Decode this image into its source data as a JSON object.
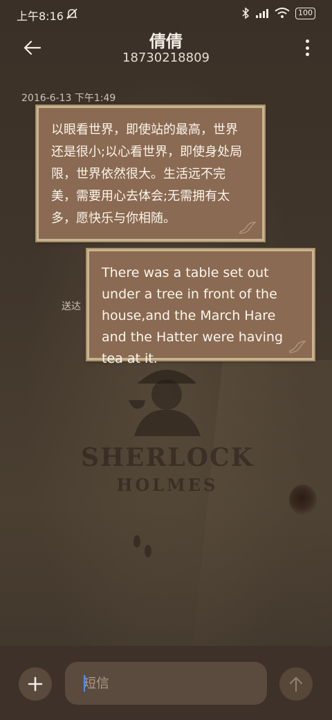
{
  "status_bar": {
    "time": "上午8:16",
    "battery": "100",
    "icons": [
      "mute-icon",
      "bluetooth-icon",
      "signal-icon",
      "wifi-icon",
      "battery-icon"
    ]
  },
  "header": {
    "contact_name": "倩倩",
    "contact_number": "18730218809",
    "icons": [
      "back-arrow-icon",
      "more-vertical-icon"
    ]
  },
  "conversation": {
    "timestamp": "2016-6-13 下午1:49",
    "messages": [
      {
        "direction": "received",
        "text": "以眼看世界，即使站的最高，世界还是很小;以心看世界，即使身处局限，世界依然很大。生活远不完美，需要用心去体会;无需拥有太多，愿快乐与你相随。"
      },
      {
        "direction": "sent",
        "text": "There was a table set out under a tree in front of the house,and the March Hare and the Hatter were having tea at it.",
        "status": "送达"
      }
    ]
  },
  "background": {
    "title_line1": "SHERLOCK",
    "title_line2": "HOLMES"
  },
  "composer": {
    "placeholder": "短信",
    "value": "",
    "icons": [
      "add-icon",
      "send-arrow-up-icon"
    ]
  },
  "colors": {
    "bubble_fill": "#8a6a52",
    "bubble_border": "#c9b58f",
    "background": "#3b3128",
    "caret": "#4a8cff"
  }
}
